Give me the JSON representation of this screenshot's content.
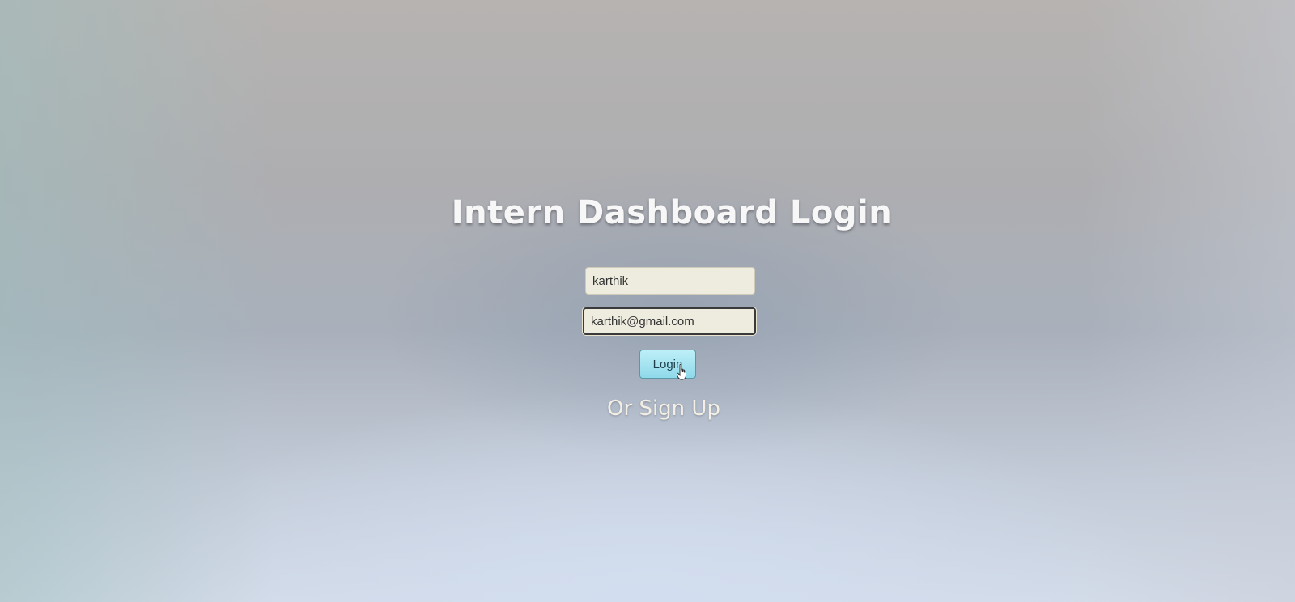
{
  "page": {
    "title": "Intern Dashboard Login"
  },
  "form": {
    "username_value": "karthik",
    "email_value": "karthik@gmail.com",
    "login_label": "Login",
    "signup_label": "Or Sign Up"
  },
  "colors": {
    "login_button": "#8fd9ea",
    "input_background": "#eeecdf",
    "title_text": "#f7f7f7"
  },
  "icons": {
    "cursor": "hand-pointer-icon"
  }
}
